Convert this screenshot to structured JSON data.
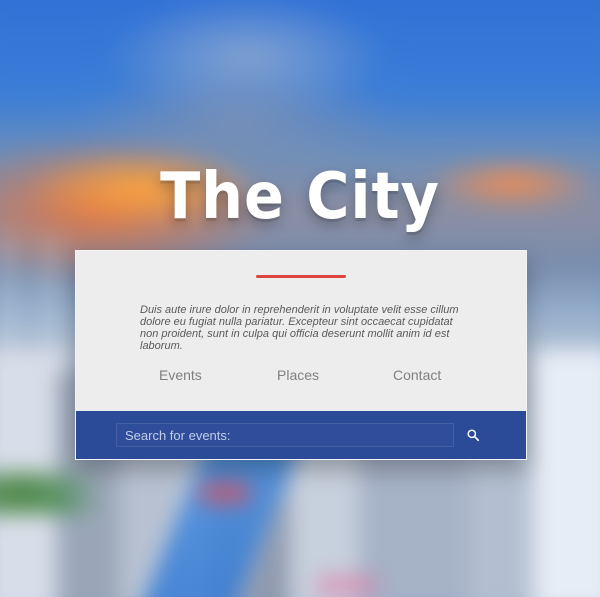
{
  "page": {
    "title": "The City"
  },
  "card": {
    "intro_text": "Duis aute irure dolor in reprehenderit in voluptate velit esse cillum dolore eu fugiat nulla pariatur. Excepteur sint occaecat cupidatat non proident, sunt in culpa qui officia deserunt mollit anim id est laborum.",
    "nav": [
      {
        "label": "Events"
      },
      {
        "label": "Places"
      },
      {
        "label": "Contact"
      }
    ],
    "search": {
      "placeholder": "Search for events:",
      "button_icon": "search-icon"
    }
  },
  "colors": {
    "accent_red": "#e0443f",
    "search_bar": "#2b4a98",
    "card_bg": "#ededed"
  }
}
